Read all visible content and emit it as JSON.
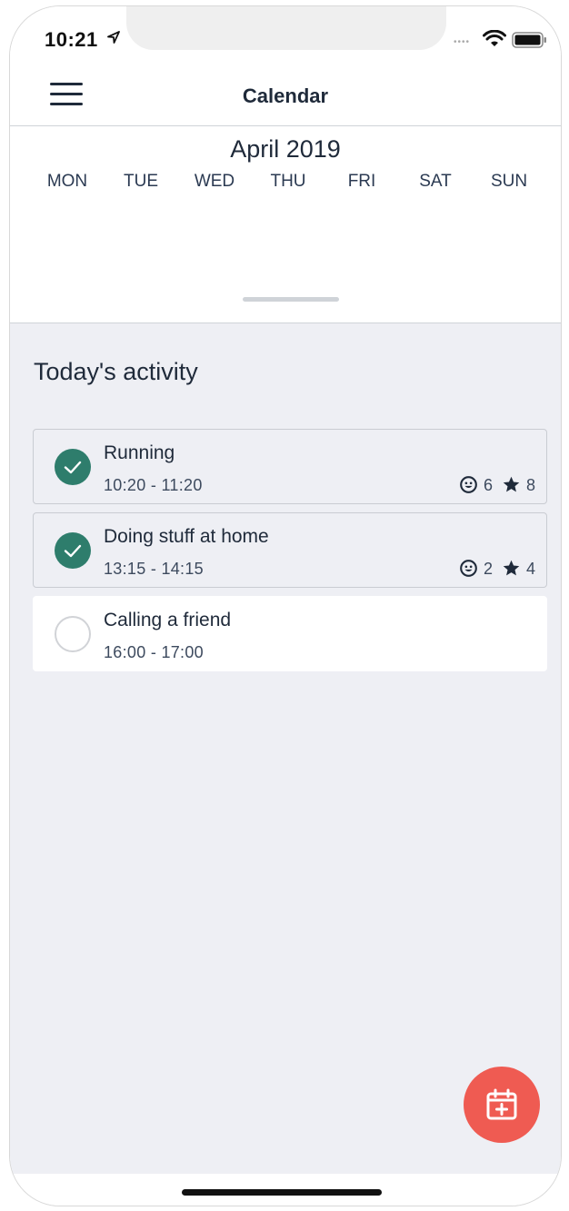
{
  "status_bar": {
    "time": "10:21",
    "icons": [
      "location-arrow-icon",
      "wifi-icon",
      "battery-icon"
    ]
  },
  "navbar": {
    "title": "Calendar",
    "menu_icon": "hamburger-menu-icon"
  },
  "calendar": {
    "month": "April 2019",
    "weekdays": [
      "MON",
      "TUE",
      "WED",
      "THU",
      "FRI",
      "SAT",
      "SUN"
    ]
  },
  "activity": {
    "title": "Today's activity",
    "items": [
      {
        "title": "Running",
        "time": "10:20 - 11:20",
        "done": true,
        "mood": "6",
        "rating": "8"
      },
      {
        "title": "Doing stuff at home",
        "time": "13:15 - 14:15",
        "done": true,
        "mood": "2",
        "rating": "4"
      },
      {
        "title": "Calling a friend",
        "time": "16:00 - 17:00",
        "done": false
      }
    ]
  },
  "fab": {
    "icon": "calendar-add-icon"
  },
  "colors": {
    "accent_green": "#2e7d6c",
    "fab_red": "#ef5b52",
    "text_dark": "#1f2a3a",
    "content_bg": "#eeeff4"
  }
}
